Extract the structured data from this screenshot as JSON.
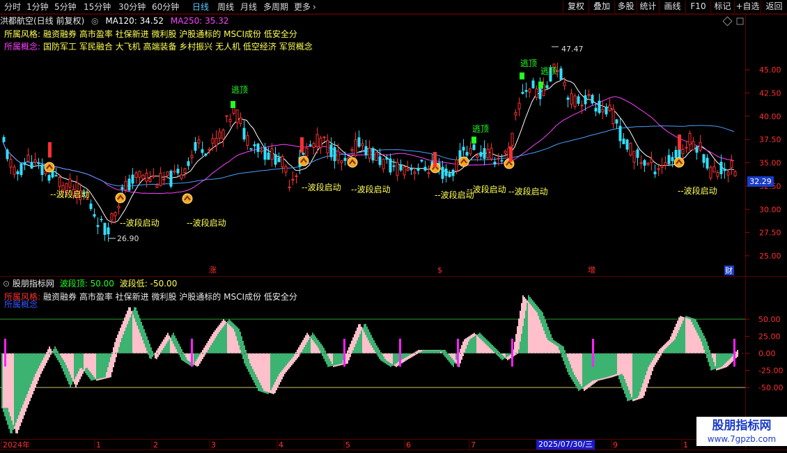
{
  "toolbar": {
    "periods": [
      "分时",
      "1分钟",
      "5分钟",
      "15分钟",
      "30分钟",
      "60分钟",
      "日线",
      "周线",
      "月线",
      "多周期",
      "更多"
    ],
    "active_period": "日线",
    "more_arrow": "›",
    "right_buttons": [
      "复权",
      "叠加",
      "多股",
      "统计",
      "画线",
      "F10",
      "标记",
      "+自选",
      "返回"
    ]
  },
  "main_chart": {
    "title": "洪都航空(日线 前复权)",
    "ma120": "MA120: 34.52",
    "ma250": "MA250: 35.32",
    "style_key": "所属风格:",
    "style_value": "融资融券 高市盈率 社保新进 微利股 沪股通标的 MSCI成份 低安全分",
    "concept_key": "所属概念:",
    "concept_value": "国防军工 军民融合 大飞机 高端装备 乡村振兴 无人机 低空经济 军贸概念",
    "y_ticks": [
      "45.00",
      "42.50",
      "40.00",
      "37.50",
      "35.00",
      "32.50",
      "30.00",
      "27.50",
      "25.00"
    ],
    "current_price": "32.29",
    "high_label": "47.47",
    "low_label": "26.90",
    "signal_label": "--波段启动",
    "escape_label": "逃顶",
    "markers": [
      "涨",
      "$",
      "增",
      "财"
    ]
  },
  "indicator": {
    "name": "股朋指标网",
    "top_label": "波段顶: 50.00",
    "low_label": "波段低: -50.00",
    "style_key": "所属风格:",
    "style_value": "融资融券 高市盈率 社保新进 微利股 沪股通标的 MSCI成份 低安全分",
    "concept_key": "所属概念",
    "y_ticks": [
      "50.00",
      "25.00",
      "0.00",
      "-25.00",
      "-50.00"
    ]
  },
  "x_axis": {
    "labels": [
      "2024年",
      "1",
      "2",
      "3",
      "4",
      "5",
      "6",
      "7",
      "2025/07/30/三",
      "9",
      "1"
    ]
  },
  "watermark": {
    "line1": "股朋指标网",
    "line2": "www.7gpzb.com"
  },
  "colors": {
    "background": "#000000",
    "up": "#ff3030",
    "down": "#30e0ff",
    "ma_white": "#ffffff",
    "ma_magenta": "#ff40ff",
    "ma_blue": "#4aa0ff",
    "pink_area": "#ffc0cb",
    "green_area": "#3cb371",
    "grid_red": "#5a0000",
    "signal_yellow": "#ffff55",
    "escape_green": "#22ff22"
  }
}
